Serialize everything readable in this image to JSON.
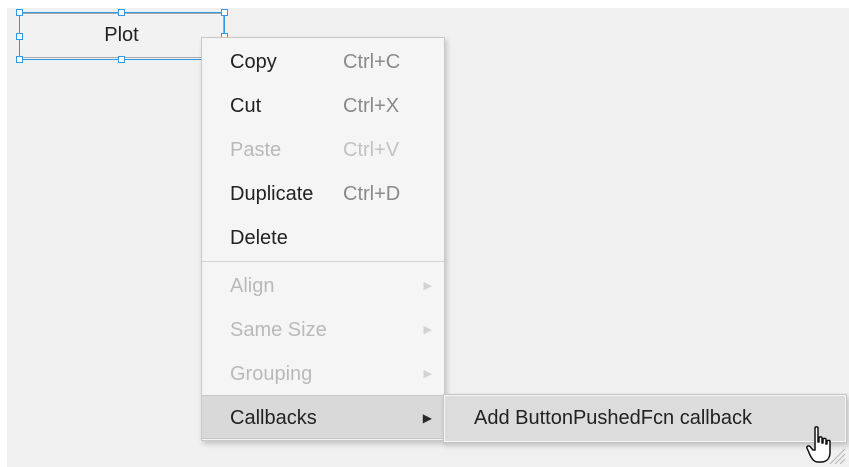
{
  "designer": {
    "plot_button_label": "Plot"
  },
  "context_menu": {
    "items": [
      {
        "label": "Copy",
        "shortcut": "Ctrl+C",
        "enabled": true
      },
      {
        "label": "Cut",
        "shortcut": "Ctrl+X",
        "enabled": true
      },
      {
        "label": "Paste",
        "shortcut": "Ctrl+V",
        "enabled": false
      },
      {
        "label": "Duplicate",
        "shortcut": "Ctrl+D",
        "enabled": true
      },
      {
        "label": "Delete",
        "shortcut": "",
        "enabled": true
      }
    ],
    "submenus": [
      {
        "label": "Align",
        "enabled": false,
        "icon": "chevron-right-icon"
      },
      {
        "label": "Same Size",
        "enabled": false,
        "icon": "chevron-right-icon"
      },
      {
        "label": "Grouping",
        "enabled": false,
        "icon": "chevron-right-icon"
      },
      {
        "label": "Callbacks",
        "enabled": true,
        "active": true,
        "icon": "triangle-right-icon"
      }
    ]
  },
  "callbacks_submenu": {
    "items": [
      {
        "label": "Add ButtonPushedFcn callback",
        "highlighted": true
      }
    ]
  },
  "cursor": {
    "icon": "hand-pointer-icon"
  },
  "colors": {
    "selection": "#2f9ae6",
    "canvas": "#f0f0f0",
    "menu_bg": "#f5f5f5",
    "highlight": "#d9d9d9"
  }
}
